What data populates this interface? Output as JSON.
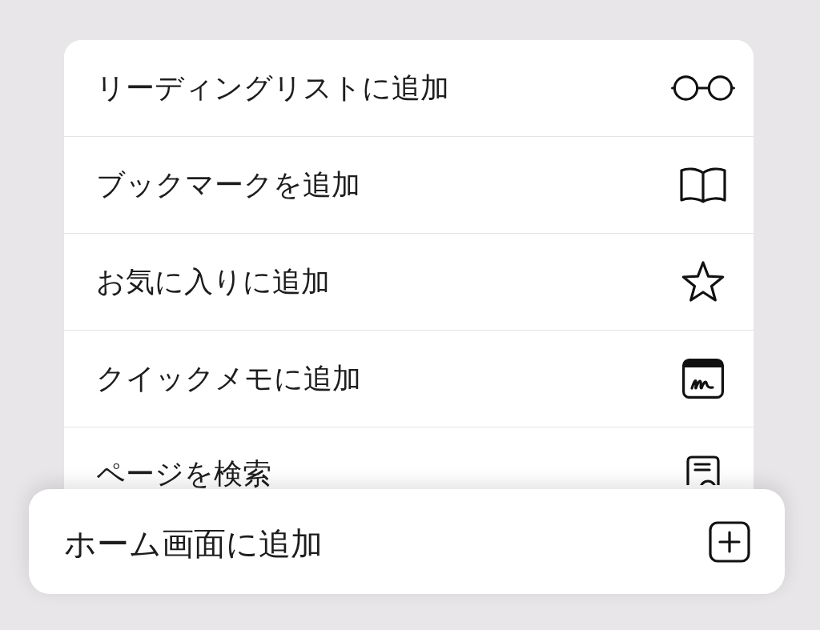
{
  "menu": {
    "items": [
      {
        "label": "リーディングリストに追加"
      },
      {
        "label": "ブックマークを追加"
      },
      {
        "label": "お気に入りに追加"
      },
      {
        "label": "クイックメモに追加"
      },
      {
        "label": "ページを検索"
      }
    ]
  },
  "home_screen_action": {
    "label": "ホーム画面に追加"
  }
}
